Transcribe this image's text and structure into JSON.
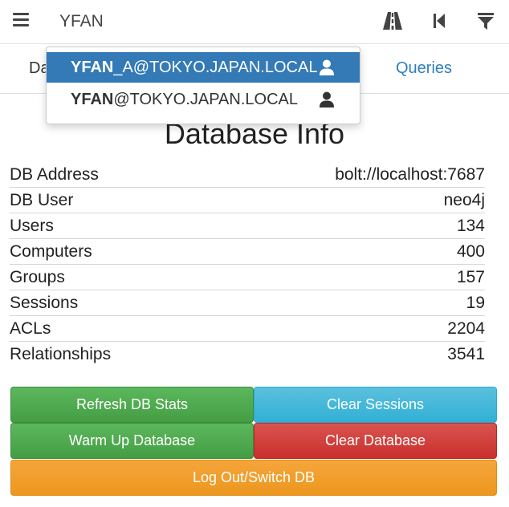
{
  "search": {
    "value": "YFAN"
  },
  "toolbar": {
    "icons": [
      "road-icon",
      "skip-back-icon",
      "filter-icon"
    ]
  },
  "tabs": {
    "database_partial": "Da",
    "queries": "Queries"
  },
  "dropdown": {
    "items": [
      {
        "match": "YFAN",
        "rest": "_A@TOKYO.JAPAN.LOCAL",
        "icon": "user-icon",
        "active": true
      },
      {
        "match": "YFAN",
        "rest": "@TOKYO.JAPAN.LOCAL",
        "icon": "user-icon",
        "active": false
      }
    ]
  },
  "database_info": {
    "title": "Database Info",
    "rows": [
      {
        "label": "DB Address",
        "value": "bolt://localhost:7687"
      },
      {
        "label": "DB User",
        "value": "neo4j"
      },
      {
        "label": "Users",
        "value": "134"
      },
      {
        "label": "Computers",
        "value": "400"
      },
      {
        "label": "Groups",
        "value": "157"
      },
      {
        "label": "Sessions",
        "value": "19"
      },
      {
        "label": "ACLs",
        "value": "2204"
      },
      {
        "label": "Relationships",
        "value": "3541"
      }
    ]
  },
  "buttons": {
    "refresh": "Refresh DB Stats",
    "clear_sessions": "Clear Sessions",
    "warm_up": "Warm Up Database",
    "clear_database": "Clear Database",
    "logout": "Log Out/Switch DB"
  },
  "colors": {
    "accent": "#337ab7",
    "link": "#2f7ec1",
    "green": "#5cb85c",
    "blue": "#5bc0de",
    "red": "#d9534f",
    "orange": "#f0ad4e"
  }
}
